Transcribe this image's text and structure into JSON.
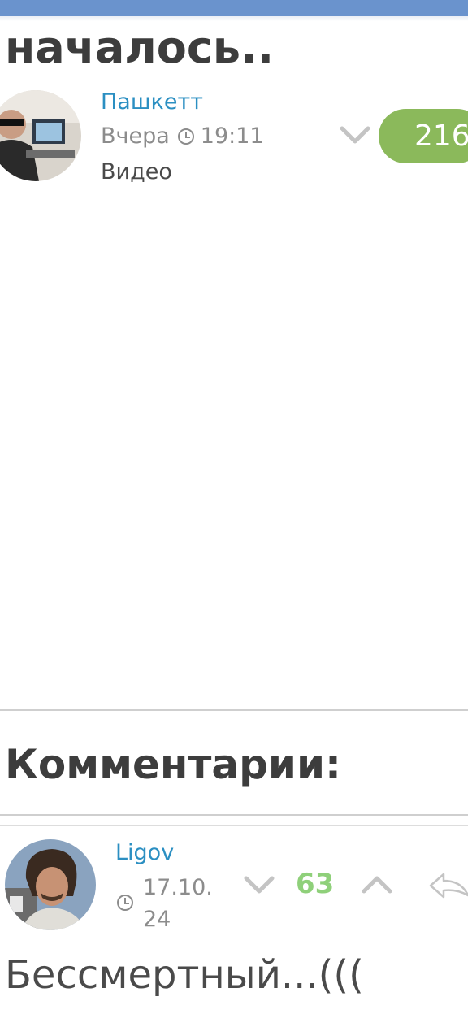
{
  "post": {
    "title": "началось..",
    "author": "Пашкетт",
    "date": "Вчера",
    "time": "19:11",
    "category": "Видео",
    "rating": "216"
  },
  "comments_section": {
    "heading": "Комментарии:"
  },
  "comments": [
    {
      "author": "Ligov",
      "date_line1": "17.10.",
      "date_line2": "24",
      "rating": "63",
      "text": "Бессмертный...((("
    }
  ],
  "colors": {
    "top_bar": "#6a93cd",
    "author_link": "#2b8fc2",
    "post_rating_pill": "#8bb95b",
    "comment_rating": "#8fd07a"
  },
  "icons": {
    "clock": "clock-icon",
    "vote_down": "chevron-down-icon",
    "vote_up": "chevron-up-icon",
    "reply": "reply-arrow-icon"
  }
}
